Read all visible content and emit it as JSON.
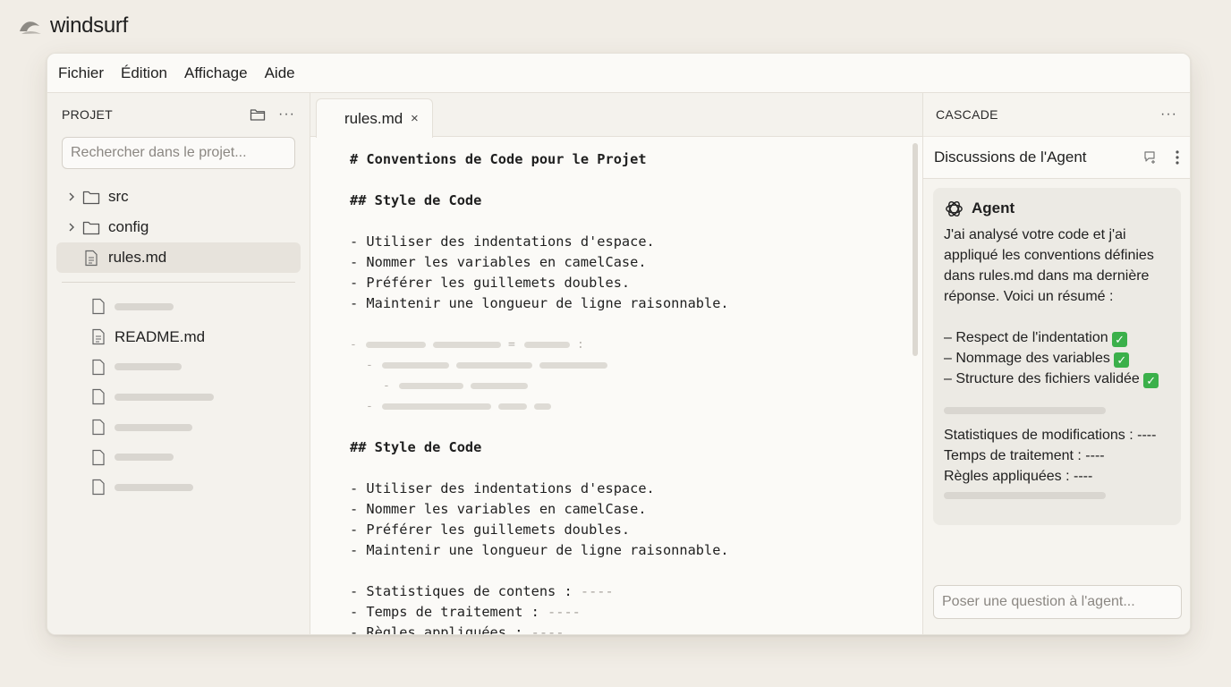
{
  "app": {
    "name": "windsurf"
  },
  "menu": [
    "Fichier",
    "Édition",
    "Affichage",
    "Aide"
  ],
  "sidebar": {
    "title": "PROJET",
    "search_placeholder": "Rechercher dans le projet...",
    "folders": [
      {
        "label": "src",
        "expanded": false
      },
      {
        "label": "config",
        "expanded": false
      }
    ],
    "active_file": "rules.md",
    "files": [
      {
        "label": "",
        "placeholder": true
      },
      {
        "label": "README.md",
        "placeholder": false
      },
      {
        "label": "",
        "placeholder": true
      },
      {
        "label": "",
        "placeholder": true
      },
      {
        "label": "",
        "placeholder": true
      },
      {
        "label": "",
        "placeholder": true
      },
      {
        "label": "",
        "placeholder": true
      }
    ]
  },
  "editor": {
    "tab_label": "rules.md",
    "tab_close": "×",
    "lines": [
      "# Conventions de Code pour le Projet",
      "",
      "## Style de Code",
      "",
      "- Utiliser des indentations d'espace.",
      "- Nommer les variables en camelCase.",
      "- Préférer les guillemets doubles.",
      "- Maintenir une longueur de ligne raisonnable.",
      "",
      "## Style de Code",
      "",
      "- Utiliser des indentations d'espace.",
      "- Nommer les variables en camelCase.",
      "- Préférer les guillemets doubles.",
      "- Maintenir une longueur de ligne raisonnable.",
      "",
      "- Statistiques de contens : ",
      "- Temps de traitement : ",
      "- Règles appliquées : "
    ],
    "dash_value": "----"
  },
  "panel": {
    "title": "CASCADE",
    "discussions_title": "Discussions de l'Agent",
    "agent_name": "Agent",
    "message": {
      "intro": "J'ai analysé votre code et j'ai appliqué les conventions définies dans rules.md dans ma dernière réponse. Voici un résumé :",
      "items": [
        "– Respect de l'indentation",
        "– Nommage des variables",
        "– Structure des fichiers validée"
      ],
      "stats": [
        "Statistiques de modifications : ----",
        "Temps de traitement : ----",
        "Règles appliquées : ----"
      ]
    },
    "ask_placeholder": "Poser une question à l'agent..."
  },
  "colors": {
    "background": "#f1ede6",
    "window": "#fbfaf7",
    "sidebar": "#f4f2ed",
    "check": "#3bb04a"
  }
}
